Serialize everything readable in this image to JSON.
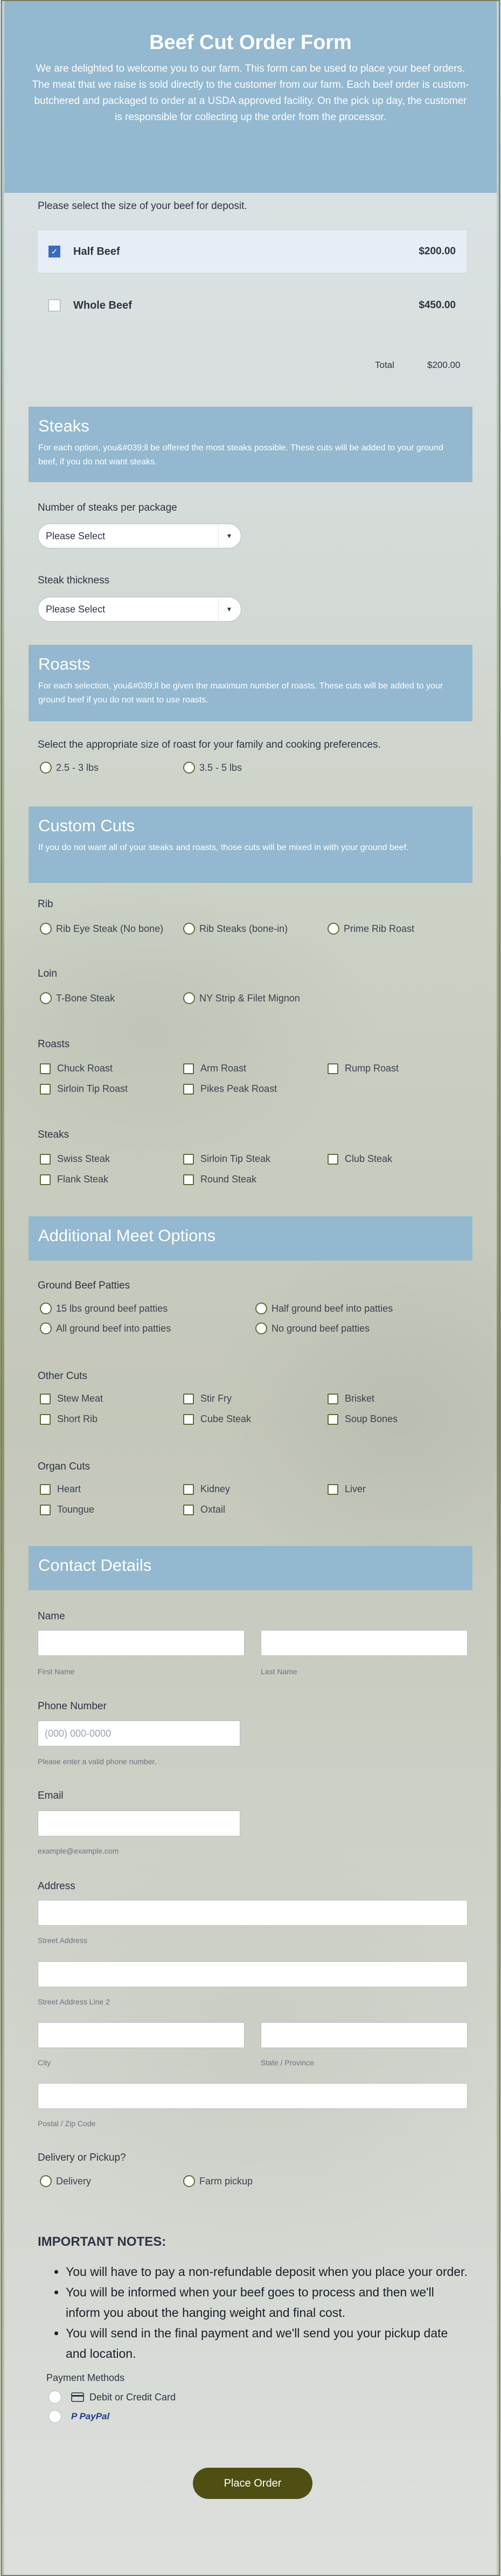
{
  "header": {
    "title": "Beef Cut Order Form",
    "description": "We are delighted to welcome you to our farm. This form can be used to place your beef orders. The meat that we raise is sold directly to the customer from our farm. Each beef order is custom-butchered and packaged to order at a USDA approved facility. On the pick up day, the customer is responsible for collecting up the order from the processor."
  },
  "deposit": {
    "label": "Please select the size of your beef for deposit.",
    "products": [
      {
        "name": "Half Beef",
        "price": "$200.00",
        "checked": true
      },
      {
        "name": "Whole Beef",
        "price": "$450.00",
        "checked": false
      }
    ],
    "total_label": "Total",
    "total_value": "$200.00"
  },
  "steaks": {
    "title": "Steaks",
    "description": "For each option, you&#039;ll be offered the most steaks possible. These cuts will be added to your ground beef, if you do not want steaks.",
    "per_package_label": "Number of steaks per package",
    "per_package_value": "Please Select",
    "thickness_label": "Steak thickness",
    "thickness_value": "Please Select"
  },
  "roasts": {
    "title": "Roasts",
    "description": "For each selection, you&#039;ll be given the maximum number of roasts. These cuts will be added to your ground beef if you do not want to use roasts.",
    "size_label": "Select the appropriate size of roast for your family and cooking preferences.",
    "options": [
      "2.5 - 3 lbs",
      "3.5 - 5 lbs"
    ]
  },
  "custom": {
    "title": "Custom Cuts",
    "description": "If you do not want all of your steaks and roasts, those cuts will be mixed in with your ground beef.",
    "rib_label": "Rib",
    "rib_options": [
      "Rib Eye Steak (No bone)",
      "Rib Steaks (bone-in)",
      "Prime Rib Roast"
    ],
    "loin_label": "Loin",
    "loin_options": [
      "T-Bone Steak",
      "NY Strip & Filet Mignon"
    ],
    "roasts_label": "Roasts",
    "roasts_options": [
      "Chuck Roast",
      "Arm Roast",
      "Rump Roast",
      "Sirloin Tip Roast",
      "Pikes Peak Roast"
    ],
    "steaks_label": "Steaks",
    "steaks_options": [
      "Swiss Steak",
      "Sirloin Tip Steak",
      "Club Steak",
      "Flank Steak",
      "Round Steak"
    ]
  },
  "additional": {
    "title": "Additional Meet Options",
    "patties_label": "Ground Beef Patties",
    "patties_options": [
      "15 lbs ground beef patties",
      "Half ground beef into patties",
      "All ground beef into patties",
      "No ground beef patties"
    ],
    "other_label": "Other Cuts",
    "other_options": [
      "Stew Meat",
      "Stir Fry",
      "Brisket",
      "Short Rib",
      "Cube Steak",
      "Soup Bones"
    ],
    "organ_label": "Organ Cuts",
    "organ_options": [
      "Heart",
      "Kidney",
      "Liver",
      "Toungue",
      "Oxtail"
    ]
  },
  "contact": {
    "title": "Contact Details",
    "name_label": "Name",
    "first_name_sub": "First Name",
    "last_name_sub": "Last Name",
    "phone_label": "Phone Number",
    "phone_placeholder": "(000) 000-0000",
    "phone_sub": "Please enter a valid phone number.",
    "email_label": "Email",
    "email_sub": "example@example.com",
    "address_label": "Address",
    "street_sub": "Street Address",
    "street2_sub": "Street Address Line 2",
    "city_sub": "City",
    "state_sub": "State / Province",
    "postal_sub": "Postal / Zip Code",
    "delivery_label": "Delivery or Pickup?",
    "delivery_options": [
      "Delivery",
      "Farm pickup"
    ]
  },
  "notes": {
    "title": "IMPORTANT NOTES:",
    "items": [
      "You will have to pay a non-refundable deposit when you place your order.",
      "You will be informed when your beef goes to process and then we'll inform you about the hanging weight and final cost.",
      "You will send in the final payment and we'll send you your pickup date and location."
    ]
  },
  "payment": {
    "label": "Payment Methods",
    "methods": [
      "Debit or Credit Card",
      "PayPal"
    ]
  },
  "submit_label": "Place Order",
  "colors": {
    "header": "#93b8d0",
    "button": "#4f4f14",
    "checkbox": "#3c6dbd"
  }
}
